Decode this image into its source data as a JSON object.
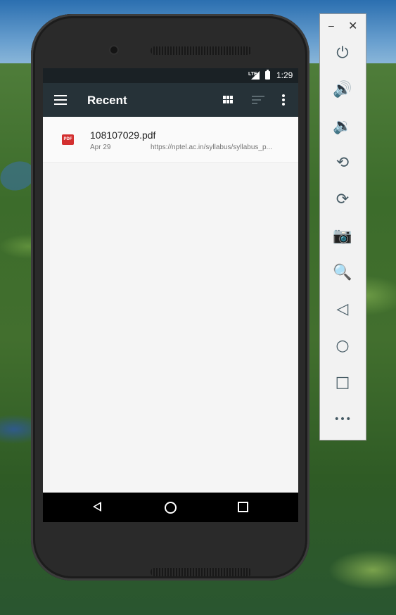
{
  "status_bar": {
    "network": "LTE",
    "time": "1:29"
  },
  "toolbar": {
    "title": "Recent"
  },
  "recent_files": [
    {
      "name": "108107029.pdf",
      "type_badge": "PDF",
      "date": "Apr 29",
      "url": "https://nptel.ac.in/syllabus/syllabus_p..."
    }
  ],
  "emulator_panel": {
    "minimize_glyph": "–",
    "close_glyph": "✕",
    "tools": [
      {
        "icon": "power-icon",
        "glyph": "⏻"
      },
      {
        "icon": "volume-up-icon",
        "glyph": "🔊"
      },
      {
        "icon": "volume-down-icon",
        "glyph": "🔉"
      },
      {
        "icon": "rotate-left-icon",
        "glyph": "⟲"
      },
      {
        "icon": "rotate-right-icon",
        "glyph": "⟳"
      },
      {
        "icon": "camera-icon",
        "glyph": "📷"
      },
      {
        "icon": "zoom-icon",
        "glyph": "🔍"
      },
      {
        "icon": "back-icon",
        "glyph": "◁"
      },
      {
        "icon": "home-icon",
        "glyph": "○"
      },
      {
        "icon": "overview-icon",
        "glyph": "□"
      },
      {
        "icon": "more-icon",
        "glyph": "•••"
      }
    ]
  },
  "colors": {
    "toolbar": "#263238",
    "status_bar": "#1a2125",
    "pdf_badge": "#d32f2f",
    "panel_icon": "#455a64"
  }
}
